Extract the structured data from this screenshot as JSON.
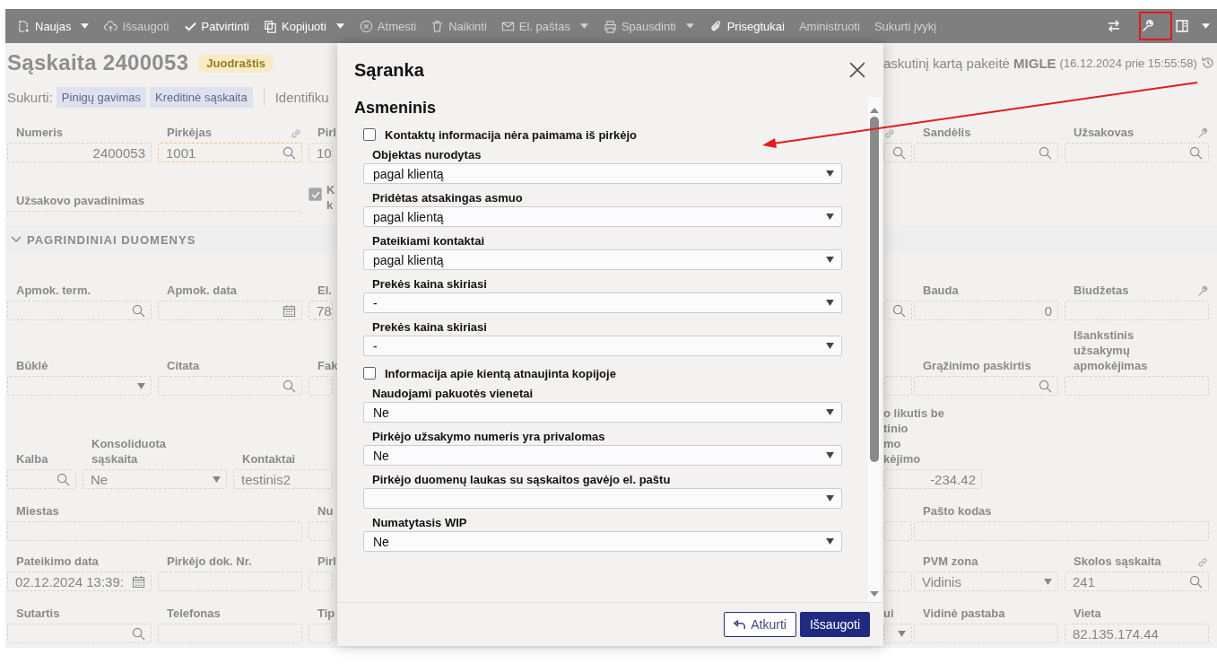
{
  "toolbar": {
    "items": [
      {
        "label": "Naujas",
        "kind": "new",
        "disabled": false,
        "dropdown": true
      },
      {
        "label": "Išsaugoti",
        "kind": "save",
        "disabled": true,
        "dropdown": false
      },
      {
        "label": "Patvirtinti",
        "kind": "confirm",
        "disabled": false,
        "dropdown": false
      },
      {
        "label": "Kopijuoti",
        "kind": "copy",
        "disabled": false,
        "dropdown": true
      },
      {
        "label": "Atmesti",
        "kind": "reject",
        "disabled": true,
        "dropdown": false
      },
      {
        "label": "Naikinti",
        "kind": "delete",
        "disabled": true,
        "dropdown": false
      },
      {
        "label": "El. paštas",
        "kind": "email",
        "disabled": true,
        "dropdown": true
      },
      {
        "label": "Spausdinti",
        "kind": "print",
        "disabled": true,
        "dropdown": true
      },
      {
        "label": "Prisegtukai",
        "kind": "attach",
        "disabled": false,
        "dropdown": false
      },
      {
        "label": "Aministruoti",
        "kind": "plain",
        "disabled": true,
        "dropdown": false
      },
      {
        "label": "Sukurti įvykį",
        "kind": "plain",
        "disabled": true,
        "dropdown": false
      }
    ]
  },
  "header": {
    "title": "Sąskaita 2400053",
    "status": "Juodraštis",
    "create_label": "Sukurti:",
    "create_buttons": [
      "Pinigų gavimas",
      "Kreditinė sąskaita"
    ],
    "identifier_fragment": "Identifiku",
    "last_change": "askutinį kartą pakeitė **MIGLE**",
    "last_change_time": "(16.12.2024 prie 15:55:58)"
  },
  "form": {
    "rows_top": [
      {
        "kind": "normal",
        "left": [
          {
            "label": "Numeris",
            "value": "2400053",
            "kind": "number"
          },
          {
            "label": "Pirkėjas",
            "value": "1001",
            "kind": "search",
            "highlight": true,
            "linked": true
          },
          {
            "label": "Pirl",
            "value": "10",
            "kind": "text"
          }
        ],
        "right": [
          {
            "kind": "search",
            "linked": true
          },
          {
            "label": "Sandėlis",
            "kind": "search"
          },
          {
            "label": "Užsakovas",
            "kind": "search",
            "has_settings": true
          }
        ]
      },
      {
        "kind": "normal",
        "left": [
          {
            "label": "Užsakovo pavadinimas",
            "kind": "text",
            "wide": true
          },
          {
            "kind": "checkbox",
            "checked": true,
            "label": [
              "K",
              "k"
            ]
          }
        ]
      }
    ],
    "section": {
      "title": "PAGRINDINIAI DUOMENYS",
      "expanded": true
    },
    "rows": [
      {
        "kind": "normal",
        "left": [
          {
            "label": "Apmok. term.",
            "kind": "search"
          },
          {
            "label": "Apmok. data",
            "kind": "date"
          },
          {
            "label": "El.",
            "value": "78",
            "kind": "text",
            "highlight": true
          }
        ],
        "right": [
          {
            "kind": "search"
          },
          {
            "label": "Bauda",
            "value": "0",
            "kind": "number"
          },
          {
            "label": "Biudžetas",
            "kind": "text",
            "has_settings": true
          }
        ]
      },
      {
        "kind": "normal",
        "left": [
          {
            "label": "Būklė",
            "kind": "select"
          },
          {
            "label": "Citata",
            "kind": "search"
          },
          {
            "label": "Fak",
            "kind": "text"
          }
        ],
        "right": [
          {
            "kind": "text"
          },
          {
            "label": "Grąžinimo paskirtis",
            "kind": "search"
          },
          {
            "label": [
              "Išankstinis",
              "užsakymų",
              "apmokėjimas"
            ],
            "kind": "text"
          }
        ]
      },
      {
        "kind": "compact",
        "left": [
          {
            "label": "Kalba",
            "kind": "search"
          },
          {
            "label": [
              "Konsoliduota",
              "sąskaita"
            ],
            "value": "Ne",
            "kind": "select"
          },
          {
            "label": "Kontaktai",
            "value": "testinis2",
            "kind": "text"
          }
        ],
        "right": [
          {
            "label": [
              "o likutis be",
              "tinio",
              "mo",
              "kėjimo"
            ],
            "value": "-234.42",
            "kind": "number",
            "wide": true
          }
        ]
      },
      {
        "kind": "normal",
        "left": [
          {
            "label": "Miestas",
            "kind": "text",
            "wide": true
          },
          {
            "label": "Nu",
            "kind": "text"
          }
        ],
        "right": [
          {
            "kind": "text"
          },
          {
            "label": "Pašto kodas",
            "kind": "text",
            "wide": true
          }
        ]
      },
      {
        "kind": "normal",
        "left": [
          {
            "label": "Pateikimo data",
            "value": "02.12.2024 13:39:",
            "kind": "date"
          },
          {
            "label": "Pirkėjo dok. Nr.",
            "kind": "text"
          },
          {
            "label": "Pirl",
            "kind": "text"
          }
        ],
        "right": [
          {
            "kind": "text"
          },
          {
            "label": "PVM zona",
            "value": "Vidinis",
            "kind": "select"
          },
          {
            "label": "Skolos sąskaita",
            "value": "241",
            "kind": "search",
            "linked": true
          }
        ]
      },
      {
        "kind": "normal",
        "left": [
          {
            "label": "Sutartis",
            "kind": "search"
          },
          {
            "label": "Telefonas",
            "kind": "text"
          },
          {
            "label": "Tip",
            "kind": "text"
          }
        ],
        "right": [
          {
            "label": "ui",
            "kind": "select"
          },
          {
            "label": "Vidinė pastaba",
            "kind": "text"
          },
          {
            "label": "Vieta",
            "value": "82.135.174.44",
            "kind": "text"
          }
        ]
      }
    ]
  },
  "dialog": {
    "title": "Sąranka",
    "section": "Asmeninis",
    "items": [
      {
        "kind": "checkbox",
        "label": "Kontaktų informacija nėra paimama iš pirkėjo",
        "checked": false
      },
      {
        "kind": "select",
        "label": "Objektas nurodytas",
        "value": "pagal klientą"
      },
      {
        "kind": "select",
        "label": "Pridėtas atsakingas asmuo",
        "value": "pagal klientą"
      },
      {
        "kind": "select",
        "label": "Pateikiami kontaktai",
        "value": "pagal klientą"
      },
      {
        "kind": "select",
        "label": "Prekės kaina skiriasi",
        "value": "-"
      },
      {
        "kind": "select",
        "label": "Prekės kaina skiriasi",
        "value": "-"
      },
      {
        "kind": "checkbox",
        "label": "Informacija apie kientą atnaujinta kopijoje",
        "checked": false
      },
      {
        "kind": "select",
        "label": "Naudojami pakuotės vienetai",
        "value": "Ne"
      },
      {
        "kind": "select",
        "label": "Pirkėjo užsakymo numeris yra privalomas",
        "value": "Ne"
      },
      {
        "kind": "select",
        "label": "Pirkėjo duomenų laukas su sąskaitos gavėjo el. paštu"
      },
      {
        "kind": "select",
        "label": "Numatytasis WIP",
        "value": "Ne"
      }
    ],
    "buttons": [
      {
        "label": "Atkurti",
        "kind": "secondary"
      },
      {
        "label": "Išsaugoti",
        "kind": "primary"
      }
    ]
  }
}
